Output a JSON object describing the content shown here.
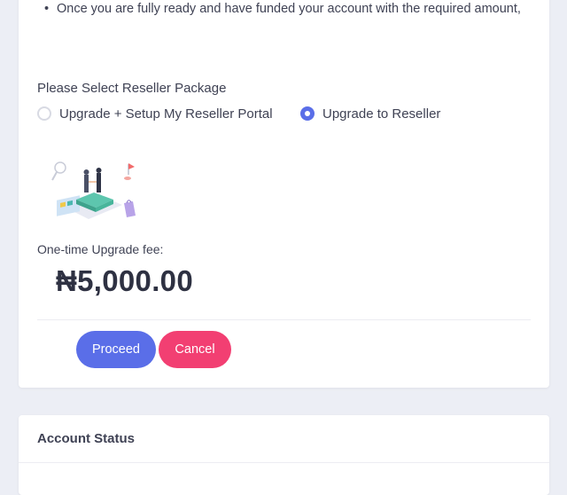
{
  "instructions": {
    "bullet_text": "Once you are fully ready and have funded your account with the required amount,"
  },
  "package": {
    "label": "Please Select Reseller Package",
    "options": [
      {
        "label": "Upgrade + Setup My Reseller Portal",
        "selected": false
      },
      {
        "label": "Upgrade to Reseller",
        "selected": true
      }
    ]
  },
  "fee": {
    "label": "One-time Upgrade fee:",
    "amount": "₦5,000.00"
  },
  "actions": {
    "proceed_label": "Proceed",
    "cancel_label": "Cancel"
  },
  "account_status": {
    "title": "Account Status"
  },
  "colors": {
    "primary": "#5a6ee8",
    "danger": "#f23f72",
    "background": "#eceef5"
  }
}
